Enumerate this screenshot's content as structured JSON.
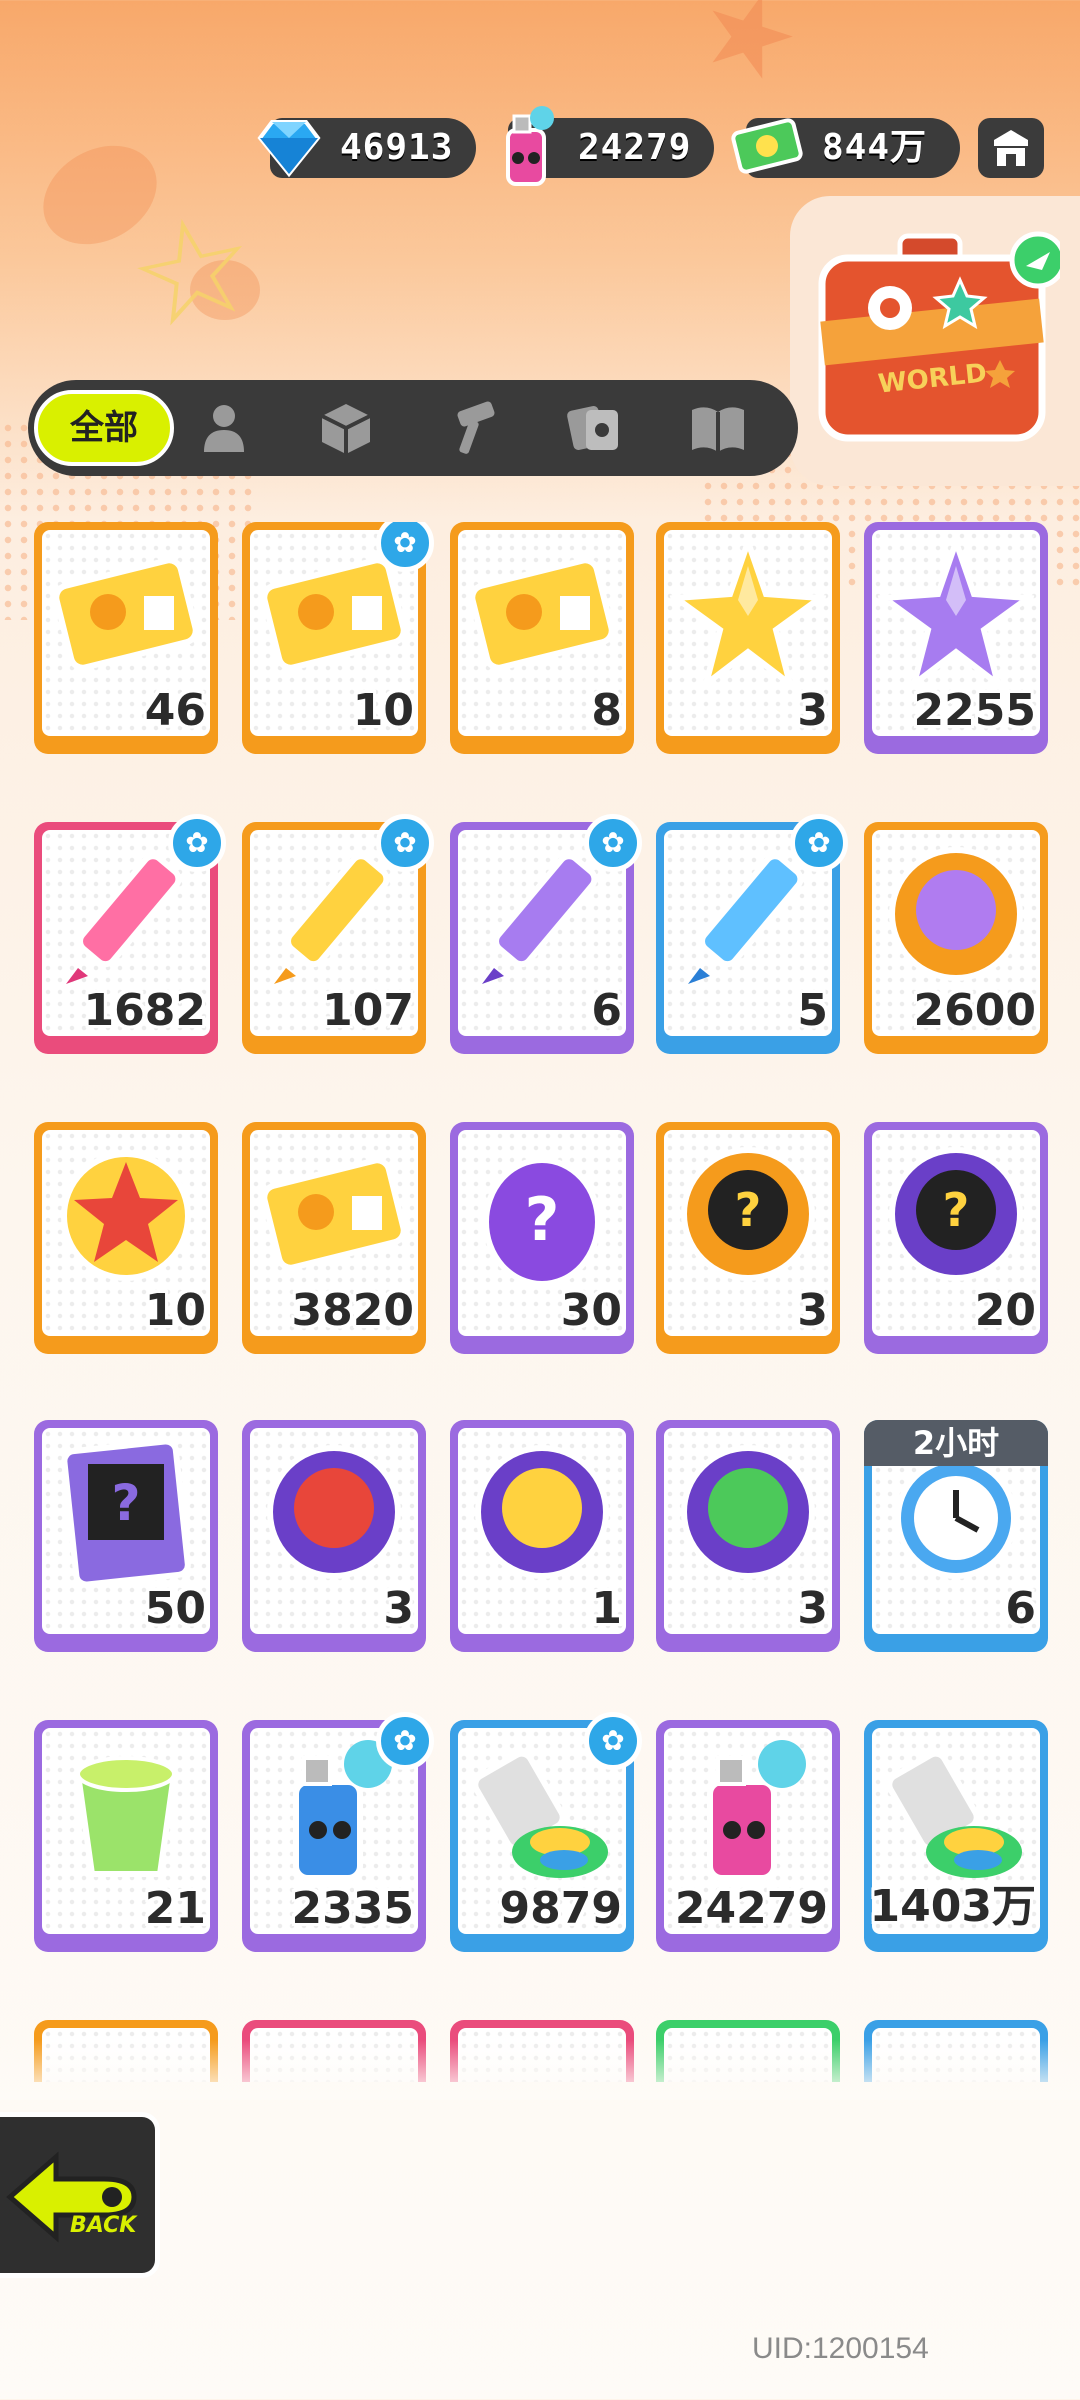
{
  "currencies": [
    {
      "name": "diamond",
      "value": "46913",
      "icon": "diamond-icon"
    },
    {
      "name": "spray-can",
      "value": "24279",
      "icon": "spray-can-icon"
    },
    {
      "name": "cash",
      "value": "844万",
      "icon": "cash-icon"
    }
  ],
  "shop_icon": "shop-icon",
  "suitcase": {
    "label": "WORLD",
    "icon": "suitcase-icon"
  },
  "tabs": [
    {
      "label": "全部",
      "icon": "",
      "active": true
    },
    {
      "label": "",
      "icon": "person-icon"
    },
    {
      "label": "",
      "icon": "box-icon"
    },
    {
      "label": "",
      "icon": "hammer-icon"
    },
    {
      "label": "",
      "icon": "cards-icon"
    },
    {
      "label": "",
      "icon": "book-icon"
    }
  ],
  "items": [
    {
      "qty": "46",
      "color": "orange",
      "icon": "gold-ticket-icon"
    },
    {
      "qty": "10",
      "color": "orange",
      "icon": "wave-ticket-icon",
      "badge": true
    },
    {
      "qty": "8",
      "color": "orange",
      "icon": "purple-ticket-icon"
    },
    {
      "qty": "3",
      "color": "orange",
      "icon": "rainbow-star-icon"
    },
    {
      "qty": "2255",
      "color": "purple",
      "icon": "purple-star-icon"
    },
    {
      "qty": "1682",
      "color": "pink",
      "icon": "pink-crayon-icon",
      "badge": true
    },
    {
      "qty": "107",
      "color": "orange",
      "icon": "yellow-crayon-icon",
      "badge": true
    },
    {
      "qty": "6",
      "color": "purple",
      "icon": "purple-crayon-icon",
      "badge": true
    },
    {
      "qty": "5",
      "color": "blue",
      "icon": "blue-crayon-icon",
      "badge": true
    },
    {
      "qty": "2600",
      "color": "orange",
      "icon": "cool-coin-icon"
    },
    {
      "qty": "10",
      "color": "orange",
      "icon": "star-burst-icon"
    },
    {
      "qty": "3820",
      "color": "orange",
      "icon": "season-ticket-icon"
    },
    {
      "qty": "30",
      "color": "purple",
      "icon": "mystery-egg-icon"
    },
    {
      "qty": "3",
      "color": "orange",
      "icon": "gold-mystery-badge-icon"
    },
    {
      "qty": "20",
      "color": "purple",
      "icon": "purple-mystery-badge-icon"
    },
    {
      "qty": "50",
      "color": "purple",
      "icon": "travel-card-icon"
    },
    {
      "qty": "3",
      "color": "purple",
      "icon": "red-fish-orb-icon"
    },
    {
      "qty": "1",
      "color": "purple",
      "icon": "yellow-squid-orb-icon"
    },
    {
      "qty": "3",
      "color": "purple",
      "icon": "plant-orb-icon"
    },
    {
      "qty": "6",
      "color": "blue",
      "icon": "alarm-clock-icon",
      "timer": "2小时"
    },
    {
      "qty": "21",
      "color": "purple",
      "icon": "green-cup-icon"
    },
    {
      "qty": "2335",
      "color": "purple",
      "icon": "blue-spray-icon",
      "badge": true
    },
    {
      "qty": "9879",
      "color": "blue",
      "icon": "paint-tube-icon",
      "badge": true
    },
    {
      "qty": "24279",
      "color": "purple",
      "icon": "pink-spray-icon"
    },
    {
      "qty": "1403万",
      "color": "blue",
      "icon": "rainbow-tube-icon"
    }
  ],
  "partial_row_colors": [
    "orange",
    "pink",
    "pink",
    "green",
    "blue"
  ],
  "back": {
    "label": "BACK",
    "icon": "back-arrow-icon"
  },
  "uid": "UID:1200154"
}
